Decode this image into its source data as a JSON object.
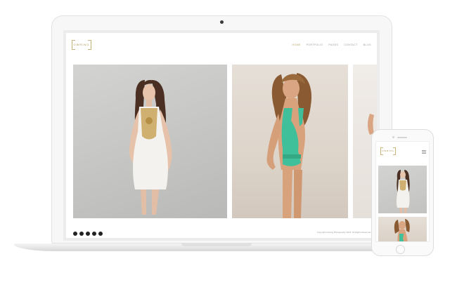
{
  "site": {
    "logo_text": "OWRING",
    "nav": [
      {
        "label": "HOME",
        "active": true
      },
      {
        "label": "PORTFOLIO",
        "active": false
      },
      {
        "label": "PAGES",
        "active": false
      },
      {
        "label": "CONTACT",
        "active": false
      },
      {
        "label": "BLOG",
        "active": false
      }
    ],
    "gallery": [
      {
        "subject": "model-in-white-dress"
      },
      {
        "subject": "model-in-green-swimsuit"
      },
      {
        "subject": "model-partial"
      }
    ],
    "social_icons": [
      "facebook-icon",
      "twitter-icon",
      "pinterest-icon",
      "instagram-icon",
      "tumblr-icon"
    ],
    "copyright": "Copyright Owring Photography 2016. All Rights Reserved."
  },
  "phone": {
    "logo_text": "OWRING",
    "menu_icon": "hamburger-icon"
  },
  "colors": {
    "accent": "#b8a468",
    "white_dress": "#f4f2ee",
    "green_swimsuit": "#3fbf9a",
    "gold_detail": "#c9a55a"
  }
}
